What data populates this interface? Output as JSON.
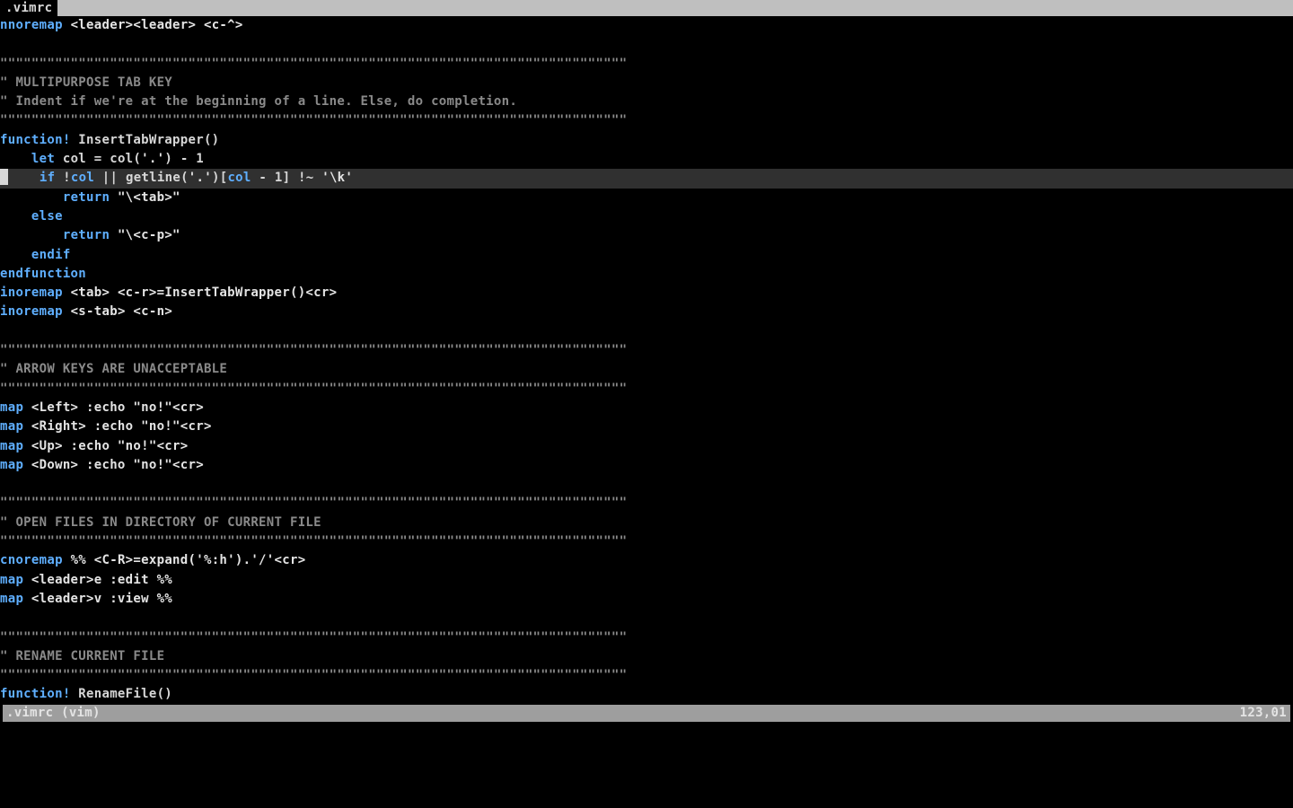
{
  "tab": {
    "filename": ".vimrc"
  },
  "status": {
    "left": ".vimrc (vim)",
    "right": "123,01"
  },
  "lines": {
    "l1_kw": "nnoremap",
    "l1_rest": " <leader><leader> <c-^>",
    "sep": "\"\"\"\"\"\"\"\"\"\"\"\"\"\"\"\"\"\"\"\"\"\"\"\"\"\"\"\"\"\"\"\"\"\"\"\"\"\"\"\"\"\"\"\"\"\"\"\"\"\"\"\"\"\"\"\"\"\"\"\"\"\"\"\"\"\"\"\"\"\"\"\"\"\"\"\"\"\"\"\"",
    "c_tab1": "\" MULTIPURPOSE TAB KEY",
    "c_tab2": "\" Indent if we're at the beginning of a line. Else, do completion.",
    "fn_kw": "function!",
    "fn_name": " InsertTabWrapper()",
    "let_pad": "    ",
    "let_kw": "let",
    "let_rest_a": " col ",
    "let_eq": "=",
    "let_rest_b": " col(",
    "let_dot": "'.'",
    "let_rest_c": ") ",
    "let_minus": "-",
    "let_one": " 1",
    "if_pad": "    ",
    "if_kw": "if",
    "if_a": " !",
    "if_col": "col",
    "if_b": " || getline(",
    "if_dot": "'.'",
    "if_c": ")[",
    "if_col2": "col",
    "if_d": " - ",
    "if_one": "1",
    "if_e": "] !~ ",
    "if_s": "'\\k'",
    "ret1_pad": "        ",
    "ret_kw": "return",
    "ret1_s": " \"\\<tab>\"",
    "else_pad": "    ",
    "else_kw": "else",
    "ret2_pad": "        ",
    "ret2_s": " \"\\<c-p>\"",
    "endif_pad": "    ",
    "endif_kw": "endif",
    "endfn_kw": "endfunction",
    "ino1_kw": "inoremap",
    "ino1_rest": " <tab> <c-r>=InsertTabWrapper()<cr>",
    "ino2_kw": "inoremap",
    "ino2_rest": " <s-tab> <c-n>",
    "c_arrow": "\" ARROW KEYS ARE UNACCEPTABLE",
    "mapL_kw": "map",
    "mapL_rest": " <Left> :echo \"no!\"<cr>",
    "mapR_kw": "map",
    "mapR_rest": " <Right> :echo \"no!\"<cr>",
    "mapU_kw": "map",
    "mapU_rest": " <Up> :echo \"no!\"<cr>",
    "mapD_kw": "map",
    "mapD_rest": " <Down> :echo \"no!\"<cr>",
    "c_open": "\" OPEN FILES IN DIRECTORY OF CURRENT FILE",
    "cno_kw": "cnoremap",
    "cno_rest": " %% <C-R>=expand('%:h').'/'<cr>",
    "mapE_kw": "map",
    "mapE_rest": " <leader>e :edit %%",
    "mapV_kw": "map",
    "mapV_rest": " <leader>v :view %%",
    "c_rename": "\" RENAME CURRENT FILE",
    "fn2_kw": "function!",
    "fn2_name": " RenameFile()"
  }
}
